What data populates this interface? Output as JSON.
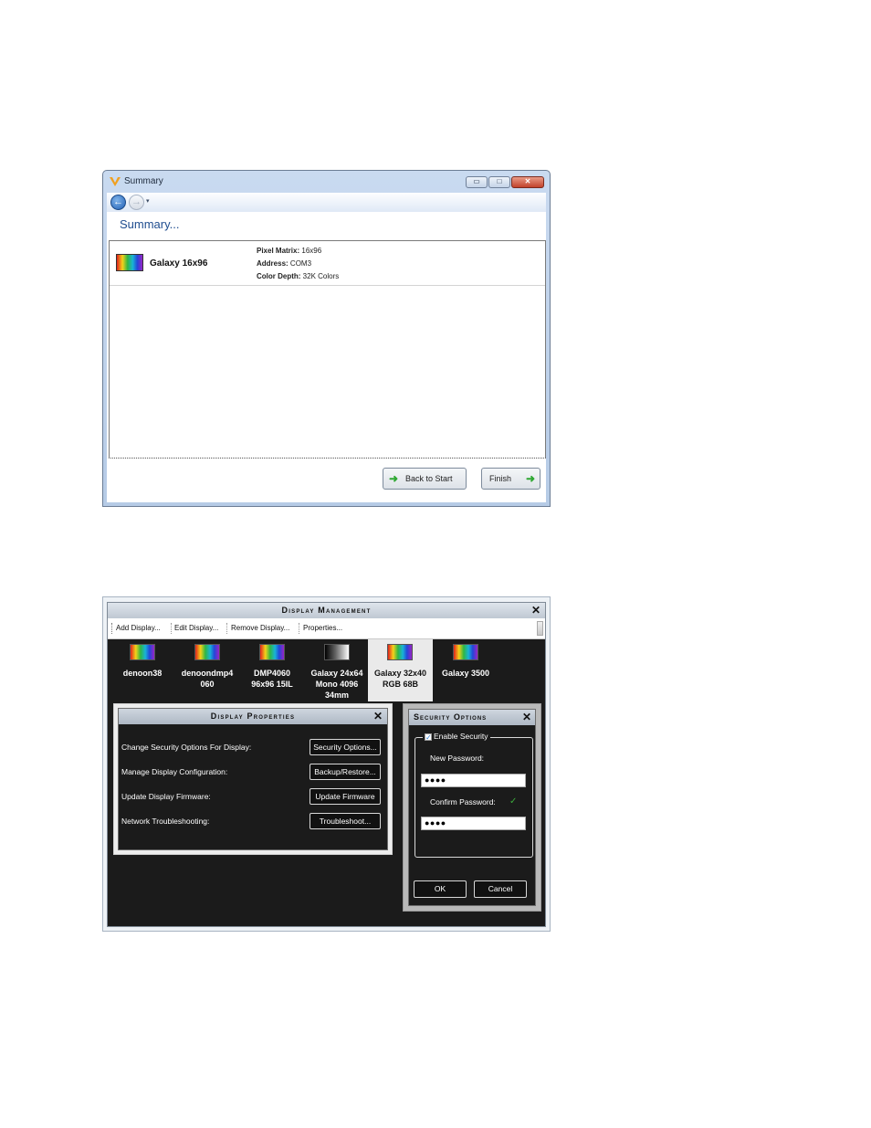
{
  "summary_window": {
    "title": "Summary",
    "min_glyph": "▭",
    "max_glyph": "□",
    "close_glyph": "✕",
    "back_glyph": "←",
    "forward_glyph": "→",
    "dropdown_glyph": "▾",
    "heading": "Summary...",
    "display": {
      "name": "Galaxy 16x96",
      "pixel_matrix_label": "Pixel Matrix:",
      "pixel_matrix_value": "16x96",
      "address_label": "Address:",
      "address_value": "COM3",
      "color_depth_label": "Color Depth:",
      "color_depth_value": "32K Colors"
    },
    "buttons": {
      "back_to_start": "Back to Start",
      "finish": "Finish"
    },
    "icons": {
      "app": "app-logo-icon",
      "back_arrow": "green-left-arrow-icon",
      "forward_arrow": "green-right-arrow-icon"
    }
  },
  "display_management": {
    "title": "Display Management",
    "close_glyph": "✕",
    "toolbar": [
      "Add Display...",
      "Edit Display...",
      "Remove Display...",
      "Properties..."
    ],
    "displays": [
      {
        "line1": "denoon38",
        "line2": "",
        "line3": "",
        "icon": "color-display-icon"
      },
      {
        "line1": "denoondmp4",
        "line2": "060",
        "line3": "",
        "icon": "color-display-icon"
      },
      {
        "line1": "DMP4060",
        "line2": "96x96 15IL",
        "line3": "",
        "icon": "color-display-icon"
      },
      {
        "line1": "Galaxy 24x64",
        "line2": "Mono 4096",
        "line3": "34mm",
        "icon": "mono-display-icon"
      },
      {
        "line1": "Galaxy 32x40",
        "line2": "RGB 68B",
        "line3": "",
        "icon": "color-display-icon",
        "selected": true
      },
      {
        "line1": "Galaxy 3500",
        "line2": "",
        "line3": "",
        "icon": "color-display-icon"
      }
    ],
    "display_properties": {
      "title": "Display Properties",
      "rows": [
        {
          "label": "Change Security Options For Display:",
          "button": "Security Options..."
        },
        {
          "label": "Manage Display Configuration:",
          "button": "Backup/Restore..."
        },
        {
          "label": "Update Display Firmware:",
          "button": "Update Firmware"
        },
        {
          "label": "Network Troubleshooting:",
          "button": "Troubleshoot..."
        }
      ]
    },
    "security_options": {
      "title": "Security Options",
      "enable_label": "Enable Security",
      "enable_checked": true,
      "check_glyph": "✓",
      "new_password_label": "New Password:",
      "new_password_value": "●●●●",
      "confirm_password_label": "Confirm Password:",
      "confirm_password_value": "●●●●",
      "ok": "OK",
      "cancel": "Cancel"
    }
  }
}
